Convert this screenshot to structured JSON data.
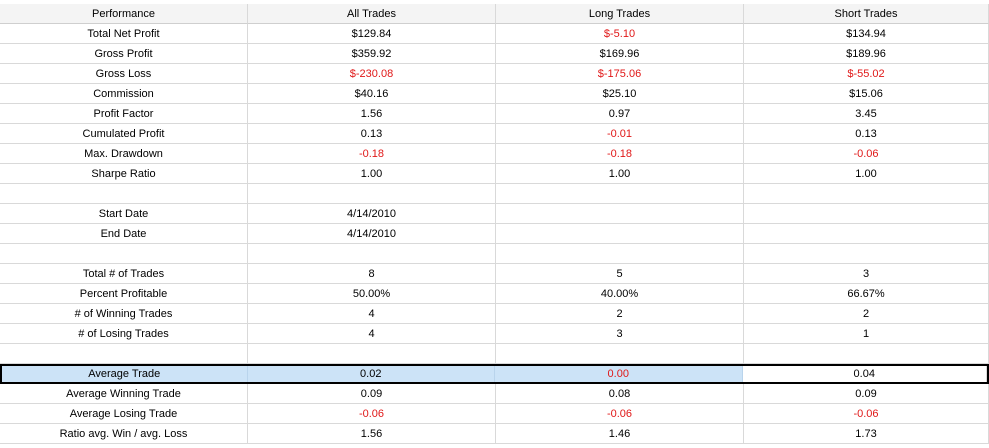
{
  "header": [
    "Performance",
    "All Trades",
    "Long Trades",
    "Short Trades"
  ],
  "negative_color": "#e01818",
  "selection_color": "#cce3f7",
  "selected_row_label": "Average Trade",
  "rows": [
    {
      "label": "Total Net Profit",
      "values": [
        "$129.84",
        "$-5.10",
        "$134.94"
      ]
    },
    {
      "label": "Gross Profit",
      "values": [
        "$359.92",
        "$169.96",
        "$189.96"
      ]
    },
    {
      "label": "Gross Loss",
      "values": [
        "$-230.08",
        "$-175.06",
        "$-55.02"
      ]
    },
    {
      "label": "Commission",
      "values": [
        "$40.16",
        "$25.10",
        "$15.06"
      ]
    },
    {
      "label": "Profit Factor",
      "values": [
        "1.56",
        "0.97",
        "3.45"
      ]
    },
    {
      "label": "Cumulated Profit",
      "values": [
        "0.13",
        "-0.01",
        "0.13"
      ]
    },
    {
      "label": "Max. Drawdown",
      "values": [
        "-0.18",
        "-0.18",
        "-0.06"
      ]
    },
    {
      "label": "Sharpe Ratio",
      "values": [
        "1.00",
        "1.00",
        "1.00"
      ]
    },
    {
      "label": "",
      "values": [
        "",
        "",
        ""
      ]
    },
    {
      "label": "Start Date",
      "values": [
        "4/14/2010",
        "",
        ""
      ]
    },
    {
      "label": "End Date",
      "values": [
        "4/14/2010",
        "",
        ""
      ]
    },
    {
      "label": "",
      "values": [
        "",
        "",
        ""
      ]
    },
    {
      "label": "Total # of Trades",
      "values": [
        "8",
        "5",
        "3"
      ]
    },
    {
      "label": "Percent Profitable",
      "values": [
        "50.00%",
        "40.00%",
        "66.67%"
      ]
    },
    {
      "label": "# of Winning Trades",
      "values": [
        "4",
        "2",
        "2"
      ]
    },
    {
      "label": "# of Losing Trades",
      "values": [
        "4",
        "3",
        "1"
      ]
    },
    {
      "label": "",
      "values": [
        "",
        "",
        ""
      ]
    },
    {
      "label": "Average Trade",
      "values": [
        "0.02",
        "0.00",
        "0.04"
      ]
    },
    {
      "label": "Average Winning Trade",
      "values": [
        "0.09",
        "0.08",
        "0.09"
      ]
    },
    {
      "label": "Average Losing Trade",
      "values": [
        "-0.06",
        "-0.06",
        "-0.06"
      ]
    },
    {
      "label": "Ratio avg. Win / avg. Loss",
      "values": [
        "1.56",
        "1.46",
        "1.73"
      ]
    }
  ]
}
